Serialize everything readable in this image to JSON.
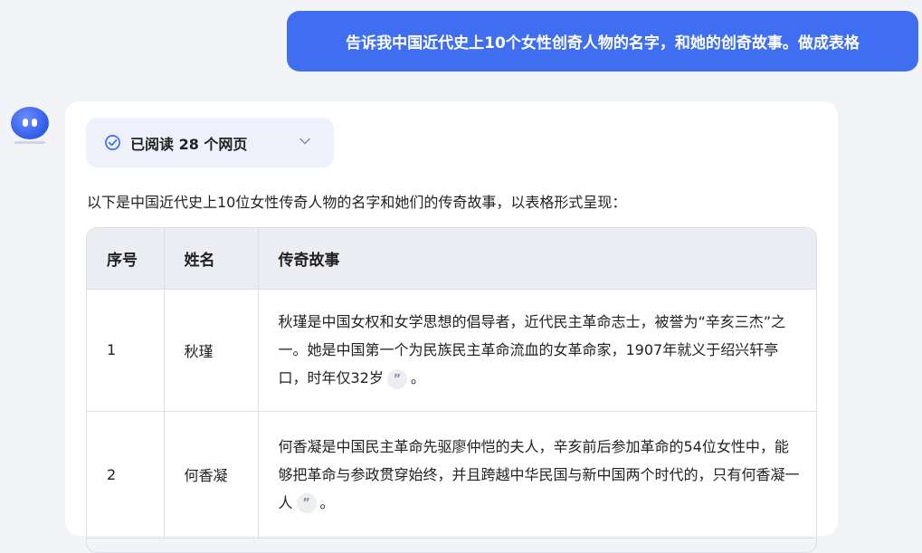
{
  "user_message": "告诉我中国近代史上10个女性创奇人物的名字，和她的创奇故事。做成表格",
  "reference_pill": {
    "label": "已阅读 28 个网页"
  },
  "intro_text": "以下是中国近代史上10位女性传奇人物的名字和她们的传奇故事，以表格形式呈现：",
  "table": {
    "headers": [
      "序号",
      "姓名",
      "传奇故事"
    ],
    "rows": [
      {
        "num": "1",
        "name": "秋瑾",
        "story": "秋瑾是中国女权和女学思想的倡导者，近代民主革命志士，被誉为“辛亥三杰”之一。她是中国第一个为民族民主革命流血的女革命家，1907年就义于绍兴轩亭口，时年仅32岁",
        "story_end": "。"
      },
      {
        "num": "2",
        "name": "何香凝",
        "story": "何香凝是中国民主革命先驱廖仲恺的夫人，辛亥前后参加革命的54位女性中，能够把革命与参政贯穿始终，并且跨越中华民国与新中国两个时代的，只有何香凝一人",
        "story_end": "。"
      }
    ]
  },
  "citation_glyph": "”",
  "colors": {
    "accent": "#3f6ff0",
    "card": "#ffffff",
    "page_bg": "#f3f4f7",
    "header_bg": "#ebedf2"
  }
}
